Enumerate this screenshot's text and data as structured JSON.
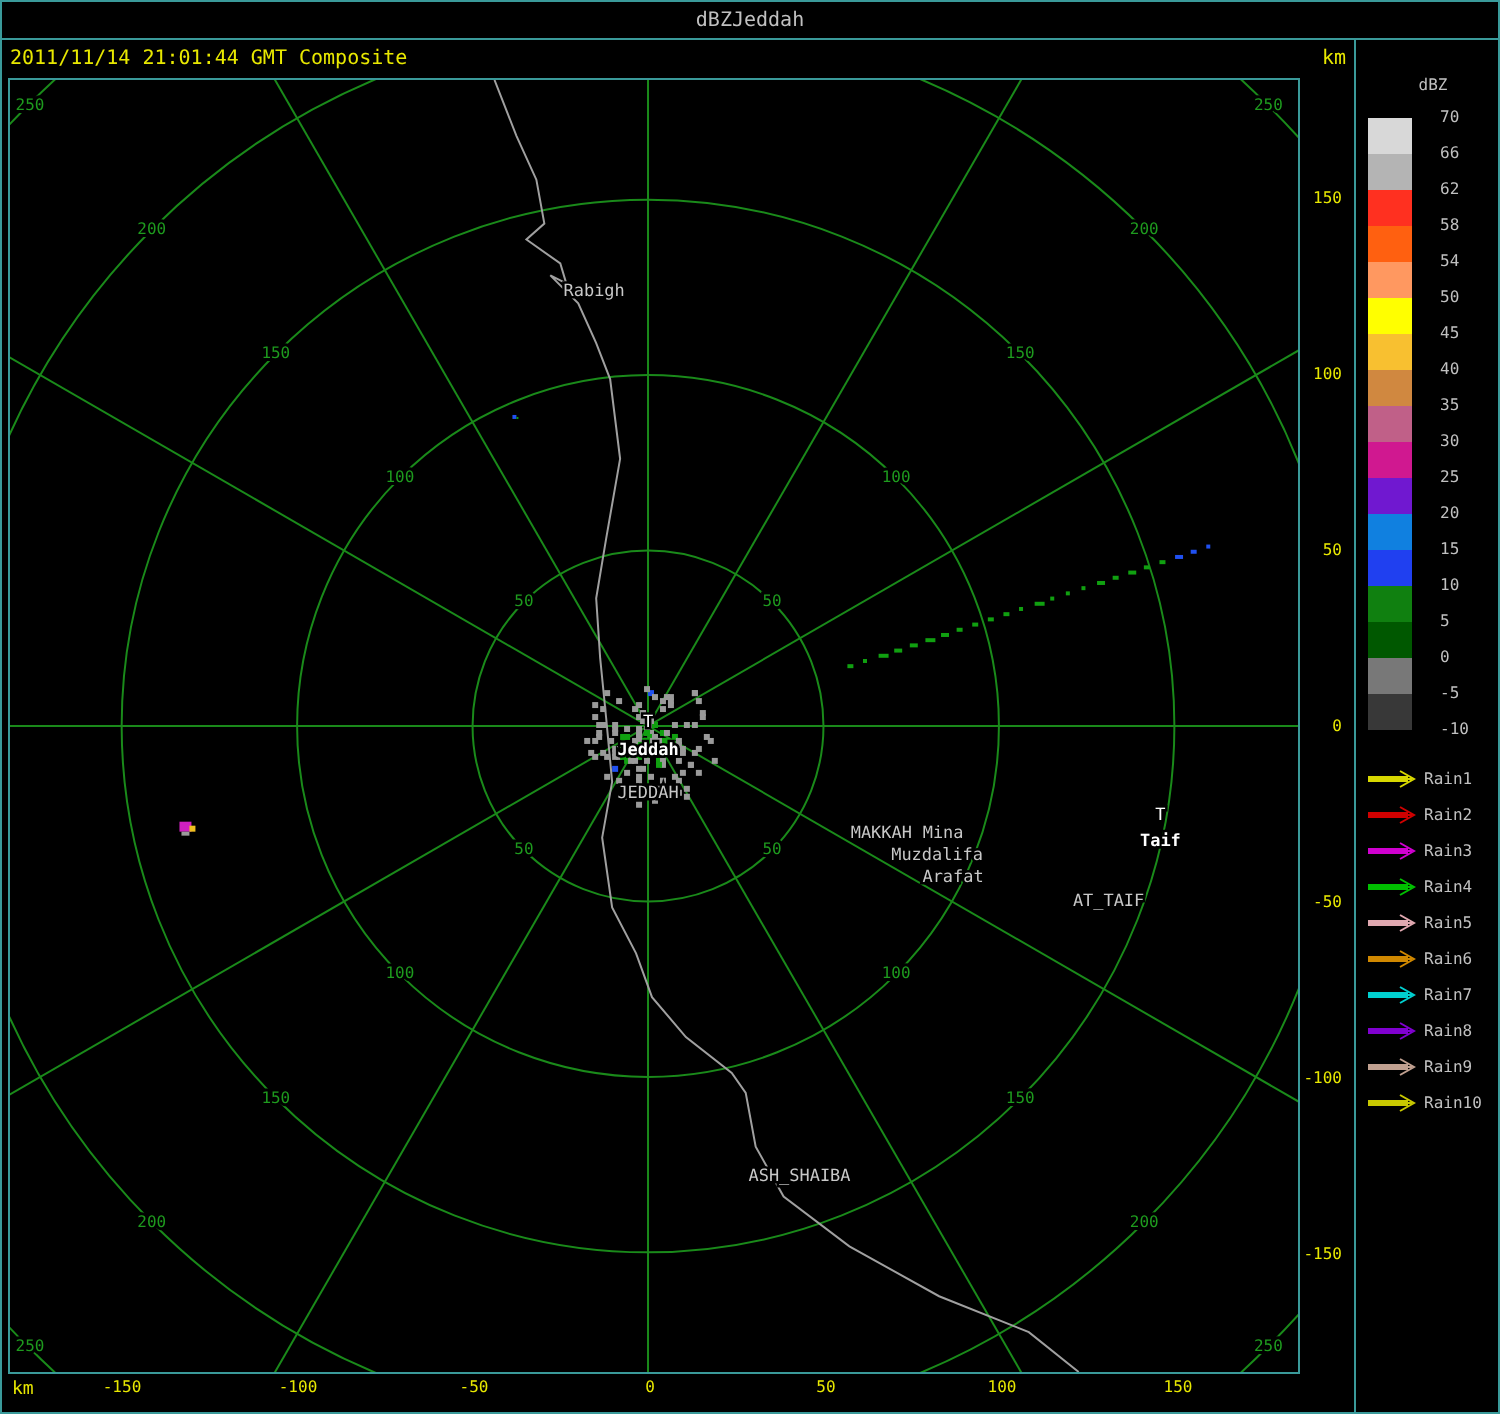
{
  "window": {
    "title": "dBZJeddah"
  },
  "header": {
    "timestamp": "2011/11/14 21:01:44 GMT Composite",
    "unit": "km"
  },
  "ring_labels": [
    [
      "50",
      "100",
      "150",
      "200",
      "250"
    ],
    [
      "50",
      "100",
      "150",
      "200",
      "250"
    ],
    [
      "50",
      "100",
      "150",
      "200",
      "250"
    ],
    [
      "50",
      "100",
      "150",
      "200",
      "250"
    ]
  ],
  "places": [
    {
      "kind": "label",
      "text": "Rabigh"
    },
    {
      "kind": "marker",
      "text": "T"
    },
    {
      "kind": "city",
      "text": "Jeddah"
    },
    {
      "kind": "label",
      "text": "JEDDAH"
    },
    {
      "kind": "label",
      "text": "MAKKAH"
    },
    {
      "kind": "label",
      "text": "Mina"
    },
    {
      "kind": "label",
      "text": "Muzdalifa"
    },
    {
      "kind": "label",
      "text": "Arafat"
    },
    {
      "kind": "marker",
      "text": "T"
    },
    {
      "kind": "city",
      "text": "Taif"
    },
    {
      "kind": "label",
      "text": "AT_TAIF"
    },
    {
      "kind": "label",
      "text": "ASH_SHAIBA"
    }
  ],
  "y_axis": {
    "labels": [
      "150",
      "100",
      "50",
      "0",
      "-50",
      "-100",
      "-150"
    ]
  },
  "x_axis": {
    "unit": "km",
    "labels": [
      "-150",
      "-100",
      "-50",
      "0",
      "50",
      "100",
      "150"
    ]
  },
  "legend": {
    "title": "dBZ",
    "bins": [
      {
        "color": "#d8d8d8"
      },
      {
        "color": "#b4b4b4"
      },
      {
        "color": "#ff3020"
      },
      {
        "color": "#ff6010"
      },
      {
        "color": "#ff9860"
      },
      {
        "color": "#ffff00"
      },
      {
        "color": "#f8c030"
      },
      {
        "color": "#d08840"
      },
      {
        "color": "#c06088"
      },
      {
        "color": "#d01890"
      },
      {
        "color": "#7018d0"
      },
      {
        "color": "#1080e0"
      },
      {
        "color": "#2040f0"
      },
      {
        "color": "#108010"
      },
      {
        "color": "#005800"
      },
      {
        "color": "#787878"
      },
      {
        "color": "#383838"
      }
    ],
    "labels": [
      "70",
      "66",
      "62",
      "58",
      "54",
      "50",
      "45",
      "40",
      "35",
      "30",
      "25",
      "20",
      "15",
      "10",
      "5",
      "0",
      "-5",
      "-10"
    ]
  },
  "tracks": [
    {
      "label": "Rain1",
      "color": "#d8d800"
    },
    {
      "label": "Rain2",
      "color": "#d00000"
    },
    {
      "label": "Rain3",
      "color": "#d000d0"
    },
    {
      "label": "Rain4",
      "color": "#00c000"
    },
    {
      "label": "Rain5",
      "color": "#e0a8b0"
    },
    {
      "label": "Rain6",
      "color": "#d08800"
    },
    {
      "label": "Rain7",
      "color": "#00d0d0"
    },
    {
      "label": "Rain8",
      "color": "#8000d0"
    },
    {
      "label": "Rain9",
      "color": "#c0a090"
    },
    {
      "label": "Rain10",
      "color": "#c8c800"
    }
  ]
}
